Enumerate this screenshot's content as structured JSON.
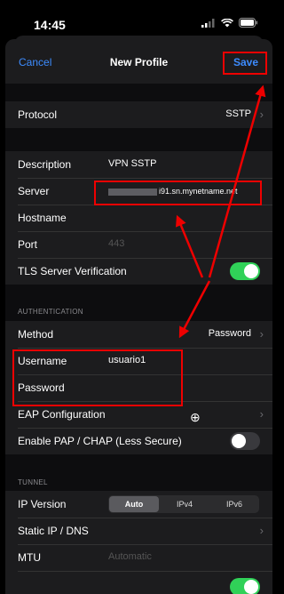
{
  "status": {
    "time": "14:45"
  },
  "nav": {
    "cancel": "Cancel",
    "title": "New Profile",
    "save": "Save"
  },
  "protocol": {
    "label": "Protocol",
    "value": "SSTP"
  },
  "server_group": {
    "description_label": "Description",
    "description_value": "VPN SSTP",
    "server_label": "Server",
    "server_value": "i91.sn.mynetname.net",
    "hostname_label": "Hostname",
    "port_label": "Port",
    "port_placeholder": "443",
    "tls_label": "TLS Server Verification",
    "tls_on": true
  },
  "authentication": {
    "header": "AUTHENTICATION",
    "method_label": "Method",
    "method_value": "Password",
    "username_label": "Username",
    "username_value": "usuario1",
    "password_label": "Password",
    "eap_label": "EAP Configuration",
    "pap_label": "Enable PAP / CHAP (Less Secure)",
    "pap_on": false
  },
  "tunnel": {
    "header": "TUNNEL",
    "ipversion_label": "IP Version",
    "ipversion_options": [
      "Auto",
      "IPv4",
      "IPv6"
    ],
    "ipversion_selected": "Auto",
    "static_label": "Static IP / DNS",
    "mtu_label": "MTU",
    "mtu_placeholder": "Automatic"
  },
  "colors": {
    "accent": "#3d8cff",
    "toggle_on": "#30d158",
    "annotation": "#e00000"
  }
}
